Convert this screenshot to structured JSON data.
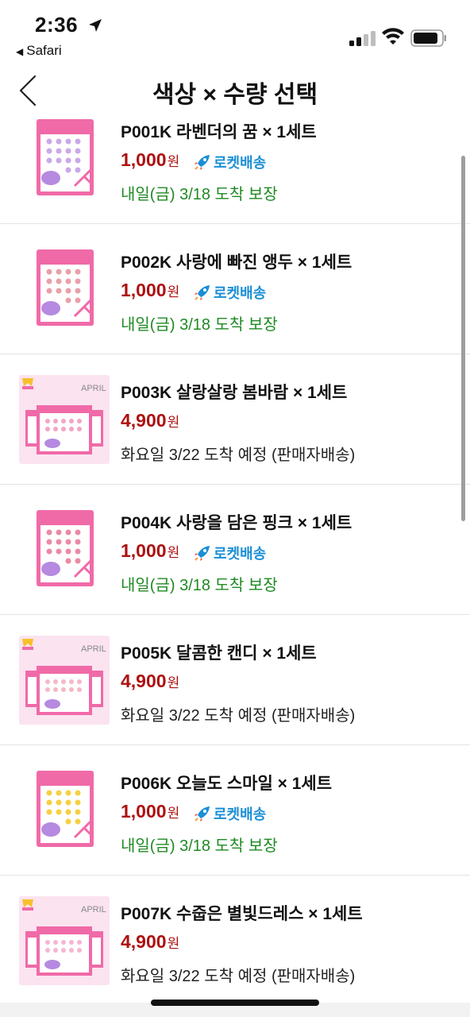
{
  "status_bar": {
    "time": "2:36",
    "back_app": "Safari"
  },
  "header": {
    "title": "색상 × 수량 선택"
  },
  "colors": {
    "price_red": "#ad1111",
    "rocket_blue": "#1a8fd6",
    "delivery_green": "#1f8a23",
    "thumb_pink": "#f06aa8"
  },
  "items": [
    {
      "name": "P001K 라벤더의 꿈 × 1세트",
      "price": "1,000",
      "won": "원",
      "rocket": "로켓배송",
      "delivery": "내일(금) 3/18 도착 보장",
      "delivery_type": "green",
      "thumb": "package-small"
    },
    {
      "name": "P002K 사랑에 빠진 앵두 × 1세트",
      "price": "1,000",
      "won": "원",
      "rocket": "로켓배송",
      "delivery": "내일(금) 3/18 도착 보장",
      "delivery_type": "green",
      "thumb": "package-small"
    },
    {
      "name": "P003K 살랑살랑 봄바람 × 1세트",
      "price": "4,900",
      "won": "원",
      "rocket": "",
      "delivery": "화요일 3/22 도착 예정 (판매자배송)",
      "delivery_type": "black",
      "thumb": "package-set",
      "thumb_text": "APRIL"
    },
    {
      "name": "P004K 사랑을 담은 핑크 × 1세트",
      "price": "1,000",
      "won": "원",
      "rocket": "로켓배송",
      "delivery": "내일(금) 3/18 도착 보장",
      "delivery_type": "green",
      "thumb": "package-small"
    },
    {
      "name": "P005K 달콤한 캔디 × 1세트",
      "price": "4,900",
      "won": "원",
      "rocket": "",
      "delivery": "화요일 3/22 도착 예정 (판매자배송)",
      "delivery_type": "black",
      "thumb": "package-set",
      "thumb_text": "APRIL"
    },
    {
      "name": "P006K 오늘도 스마일 × 1세트",
      "price": "1,000",
      "won": "원",
      "rocket": "로켓배송",
      "delivery": "내일(금) 3/18 도착 보장",
      "delivery_type": "green",
      "thumb": "package-small"
    },
    {
      "name": "P007K 수줍은 별빛드레스 × 1세트",
      "price": "4,900",
      "won": "원",
      "rocket": "",
      "delivery": "화요일 3/22 도착 예정 (판매자배송)",
      "delivery_type": "black",
      "thumb": "package-set",
      "thumb_text": "APRIL"
    }
  ]
}
